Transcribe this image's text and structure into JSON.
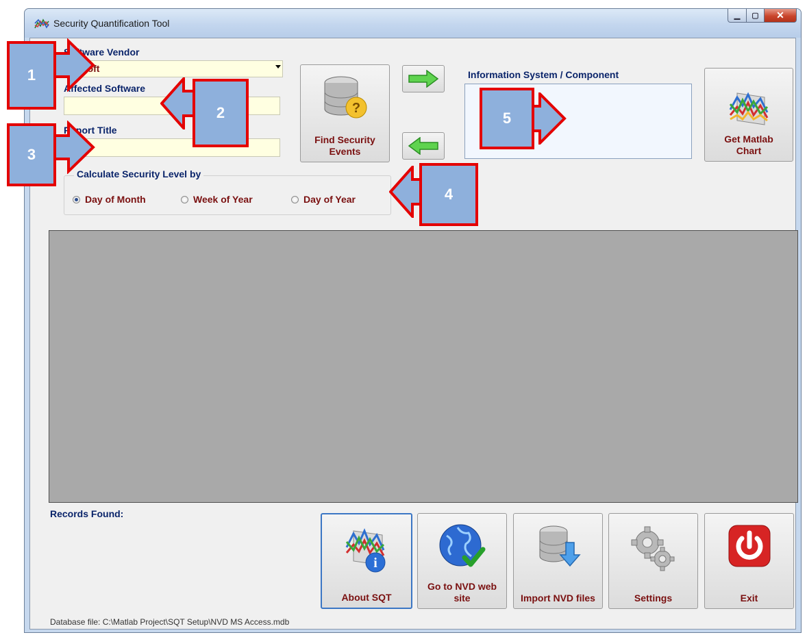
{
  "window": {
    "title": "Security Quantification Tool"
  },
  "form": {
    "vendor_label": "Software Vendor",
    "vendor_value": "crosoft",
    "affected_label": "Affected Software",
    "affected_value": "",
    "report_label": "Report Title",
    "report_value": ""
  },
  "calc_group": {
    "title": "Calculate Security Level by",
    "options": [
      {
        "label": "Day of Month",
        "selected": true
      },
      {
        "label": "Week of Year",
        "selected": false
      },
      {
        "label": "Day of Year",
        "selected": false
      }
    ]
  },
  "buttons": {
    "find_events": "Find Security Events",
    "get_chart": "Get Matlab Chart",
    "about": "About SQT",
    "nvd_site": "Go to NVD web site",
    "import_nvd": "Import NVD files",
    "settings": "Settings",
    "exit": "Exit"
  },
  "info_system": {
    "label": "Information System / Component"
  },
  "records": {
    "label": "Records Found:"
  },
  "status": {
    "db_file": "Database file: C:\\Matlab Project\\SQT Setup\\NVD MS Access.mdb"
  },
  "callouts": [
    "1",
    "2",
    "3",
    "4",
    "5"
  ],
  "colors": {
    "accent_text": "#7a1010",
    "label_text": "#0a246a",
    "callout_fill": "#8eb0dc",
    "callout_border": "#e40000"
  }
}
